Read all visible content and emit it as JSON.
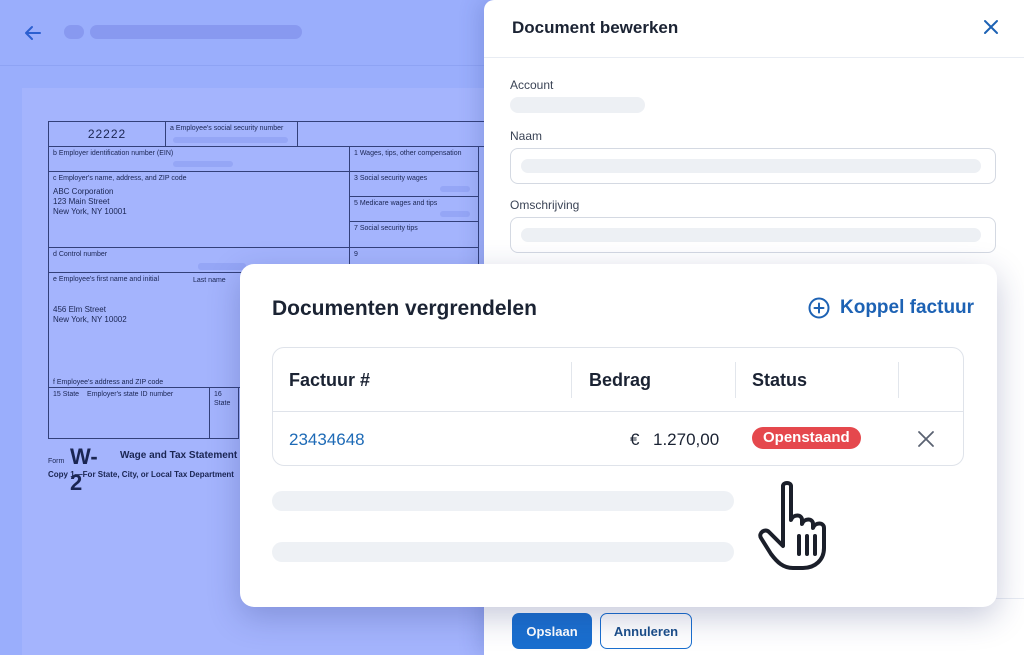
{
  "w2": {
    "control_code": "22222",
    "box_a": "a  Employee's social security number",
    "box_b": "b  Employer identification number (EIN)",
    "box_1": "1  Wages, tips, other compensation",
    "box_c": "c  Employer's name, address, and ZIP code",
    "employer_name": "ABC Corporation",
    "employer_street": "123 Main Street",
    "employer_city": "New York, NY 10001",
    "box_3": "3  Social security wages",
    "box_5": "5  Medicare wages and tips",
    "box_7": "7  Social security tips",
    "box_d": "d  Control number",
    "box_9": "9",
    "box_e": "e  Employee's first name and initial",
    "last_name": "Last name",
    "employee_street": "456 Elm Street",
    "employee_city": "New York, NY 10002",
    "box_f": "f  Employee's address and ZIP code",
    "box_15": "15  State",
    "box_15b": "Employer's state ID number",
    "box_16": "16  State",
    "form_word": "Form",
    "form_code": "W-2",
    "form_title": "Wage and Tax Statement",
    "copy_line": "Copy 1—For State, City, or Local Tax Department"
  },
  "panel": {
    "title": "Document bewerken",
    "account_label": "Account",
    "naam_label": "Naam",
    "omschrijving_label": "Omschrijving",
    "save_label": "Opslaan",
    "cancel_label": "Annuleren"
  },
  "modal": {
    "title": "Documenten vergrendelen",
    "link_label": "Koppel factuur",
    "columns": [
      "Factuur #",
      "Bedrag",
      "Status"
    ],
    "rows": [
      {
        "invoice": "23434648",
        "currency": "€",
        "amount": "1.270,00",
        "status": "Openstaand"
      }
    ]
  },
  "colors": {
    "accent": "#1a6fcf",
    "status_open": "#e5484d",
    "background": "#9aaefc"
  },
  "icons": {
    "back": "back-arrow-icon",
    "close": "close-icon",
    "add": "plus-circle-icon",
    "remove": "close-icon",
    "cursor": "hand-pointer-icon"
  }
}
